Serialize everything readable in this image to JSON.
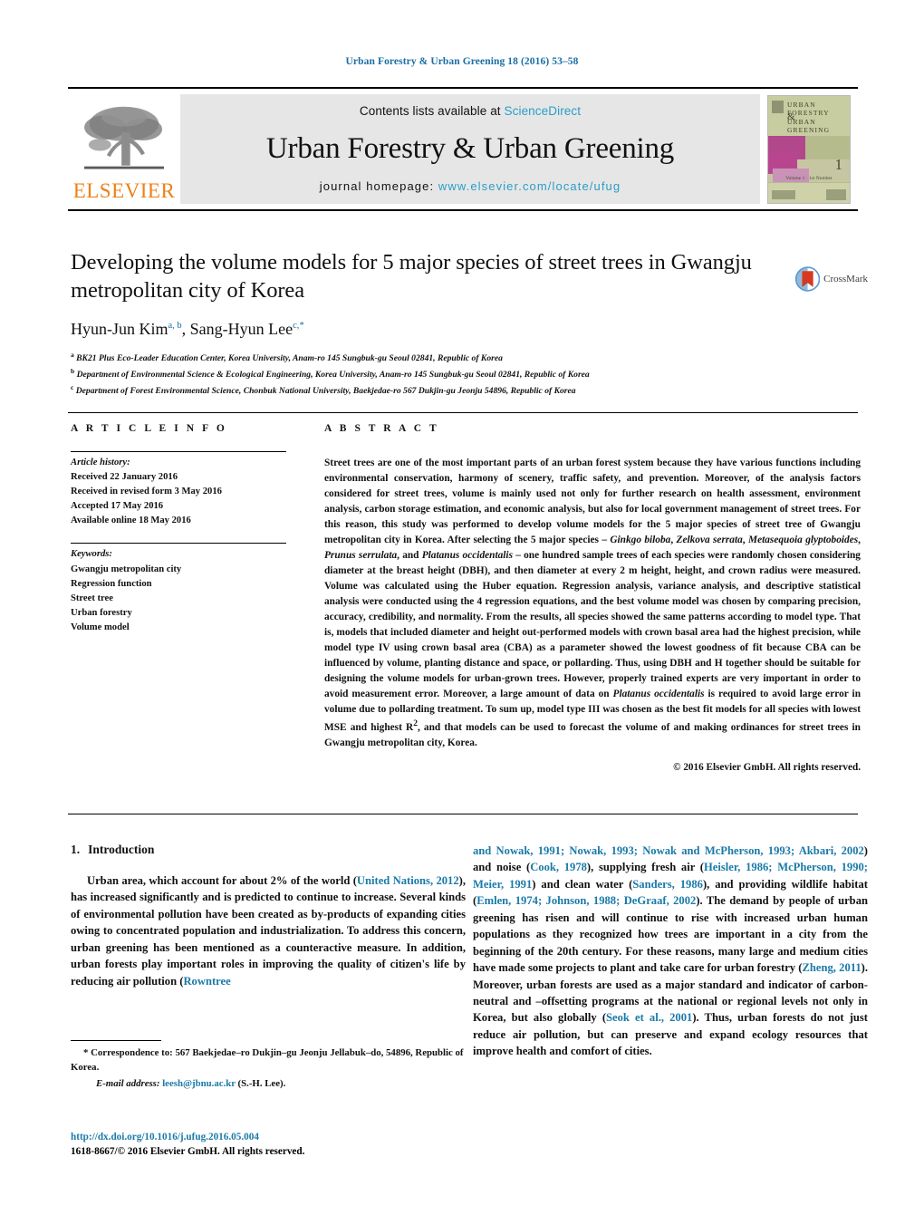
{
  "running_head": "Urban Forestry & Urban Greening 18 (2016) 53–58",
  "masthead": {
    "publisher_name": "ELSEVIER",
    "contents_prefix": "Contents lists available at ",
    "contents_link": "ScienceDirect",
    "journal_title": "Urban Forestry & Urban Greening",
    "homepage_prefix": "journal homepage: ",
    "homepage_url": "www.elsevier.com/locate/ufug",
    "cover": {
      "line1": "URBAN",
      "line2": "FORESTRY",
      "line3": "URBAN",
      "line4": "GREENING",
      "amp": "&",
      "issue_number": "1",
      "volume_note": "Volume 1 · 1st Number"
    }
  },
  "article": {
    "title": "Developing the volume models for 5 major species of street trees in Gwangju metropolitan city of Korea",
    "authors_html": "Hyun-Jun Kim<sup>a, b</sup>, Sang-Hyun Lee<sup>c,</sup><sup>*</sup>",
    "affiliations": [
      {
        "marker": "a",
        "text": "BK21 Plus Eco-Leader Education Center, Korea University, Anam-ro 145 Sungbuk-gu Seoul 02841, Republic of Korea"
      },
      {
        "marker": "b",
        "text": "Department of Environmental Science & Ecological Engineering, Korea University, Anam-ro 145 Sungbuk-gu Seoul 02841, Republic of Korea"
      },
      {
        "marker": "c",
        "text": "Department of Forest Environmental Science, Chonbuk National University, Baekjedae-ro 567 Dukjin-gu Jeonju 54896, Republic of Korea"
      }
    ],
    "crossmark_label": "CrossMark"
  },
  "info": {
    "heading": "A R T I C L E   I N F O",
    "history_label": "Article history:",
    "history": [
      "Received 22 January 2016",
      "Received in revised form 3 May 2016",
      "Accepted 17 May 2016",
      "Available online 18 May 2016"
    ],
    "keywords_label": "Keywords:",
    "keywords": [
      "Gwangju metropolitan city",
      "Regression function",
      "Street tree",
      "Urban forestry",
      "Volume model"
    ]
  },
  "abstract": {
    "heading": "A B S T R A C T",
    "paragraph_html": "Street trees are one of the most important parts of an urban forest system because they have various functions including environmental conservation, harmony of scenery, traffic safety, and prevention. Moreover, of the analysis factors considered for street trees, volume is mainly used not only for further research on health assessment, environment analysis, carbon storage estimation, and economic analysis, but also for local government management of street trees. For this reason, this study was performed to develop volume models for the 5 major species of street tree of Gwangju metropolitan city in Korea. After selecting the 5 major species – <i>Ginkgo biloba</i>, <i>Zelkova serrata</i>, <i>Metasequoia glyptoboides</i>, <i>Prunus serrulata</i>, and <i>Platanus occidentalis</i> – one hundred sample trees of each species were randomly chosen considering diameter at the breast height (DBH), and then diameter at every 2 m height, height, and crown radius were measured. Volume was calculated using the Huber equation. Regression analysis, variance analysis, and descriptive statistical analysis were conducted using the 4 regression equations, and the best volume model was chosen by comparing precision, accuracy, credibility, and normality. From the results, all species showed the same patterns according to model type. That is, models that included diameter and height out-performed models with crown basal area had the highest precision, while model type IV using crown basal area (CBA) as a parameter showed the lowest goodness of fit because CBA can be influenced by volume, planting distance and space, or pollarding. Thus, using DBH and H together should be suitable for designing the volume models for urban-grown trees. However, properly trained experts are very important in order to avoid measurement error. Moreover, a large amount of data on <i>Platanus occidentalis</i> is required to avoid large error in volume due to pollarding treatment. To sum up, model type III was chosen as the best fit models for all species with lowest MSE and highest R<sup>2</sup>, and that models can be used to forecast the volume of and making ordinances for street trees in Gwangju metropolitan city, Korea.",
    "copyright": "© 2016 Elsevier GmbH. All rights reserved."
  },
  "introduction": {
    "number": "1.",
    "title": "Introduction",
    "left_paragraph_html": "Urban area, which account for about 2% of the world (<span class=\"ref\">United Nations, 2012</span>), has increased significantly and is predicted to continue to increase. Several kinds of environmental pollution have been created as by-products of expanding cities owing to concentrated population and industrialization. To address this concern, urban greening has been mentioned as a counteractive measure. In addition, urban forests play important roles in improving the quality of citizen's life by reducing air pollution (<span class=\"ref\">Rowntree</span>",
    "right_paragraph_html": "<span class=\"ref\">and Nowak, 1991; Nowak, 1993; Nowak and McPherson, 1993; Akbari, 2002</span>) and noise (<span class=\"ref\">Cook, 1978</span>), supplying fresh air (<span class=\"ref\">Heisler, 1986; McPherson, 1990; Meier, 1991</span>) and clean water (<span class=\"ref\">Sanders, 1986</span>), and providing wildlife habitat (<span class=\"ref\">Emlen, 1974; Johnson, 1988; DeGraaf, 2002</span>). The demand by people of urban greening has risen and will continue to rise with increased urban human populations as they recognized how trees are important in a city from the beginning of the 20th century. For these reasons, many large and medium cities have made some projects to plant and take care for urban forestry (<span class=\"ref\">Zheng, 2011</span>). Moreover, urban forests are used as a major standard and indicator of carbon-neutral and –offsetting programs at the national or regional levels not only in Korea, but also globally (<span class=\"ref\">Seok et al., 2001</span>). Thus, urban forests do not just reduce air pollution, but can preserve and expand ecology resources that improve health and comfort of cities."
  },
  "footnotes": {
    "correspondence_html": "* Correspondence to: 567 Baekjedae–ro Dukjin–gu Jeonju Jellabuk–do, 54896, Republic of Korea.",
    "email_label": "E-mail address:",
    "email": "leesh@jbnu.ac.kr",
    "email_suffix": "(S.-H. Lee)."
  },
  "doi": {
    "url": "http://dx.doi.org/10.1016/j.ufug.2016.05.004",
    "issn_line": "1618-8667/© 2016 Elsevier GmbH. All rights reserved."
  },
  "colors": {
    "link_blue": "#1a7aa8",
    "sciencedirect_blue": "#2a9ec7",
    "elsevier_orange": "#ec8019",
    "masthead_gray": "#e6e6e6"
  }
}
